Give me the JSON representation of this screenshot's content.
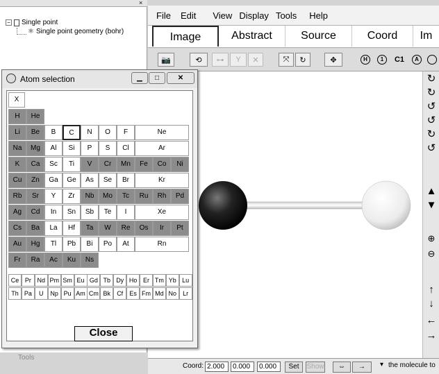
{
  "tree": {
    "root_label": "Single point",
    "child_label": "Single point geometry (bohr)",
    "collapse_glyph": "⊟",
    "close_glyph": "×"
  },
  "tools_label": "Tools",
  "menu": [
    "File",
    "Edit",
    "View",
    "Display",
    "Tools",
    "Help"
  ],
  "tabs": [
    "Image",
    "Abstract",
    "Source",
    "Coord",
    "Im"
  ],
  "toolbar_labels": {
    "h": "H",
    "one": "1",
    "c1": "C1",
    "a": "A"
  },
  "molecule": {
    "atoms": [
      {
        "element": "C",
        "color": "#1a1a1a"
      },
      {
        "element": "H",
        "color": "#f2f2f2"
      }
    ]
  },
  "right_tools": [
    "rotate-x-icon",
    "rotate-y-icon",
    "rotate-z-icon",
    "rotate-reverse-icon",
    "rotate-c-icon",
    "rotate-undo-icon",
    "arrow-up-icon",
    "arrow-down-icon",
    "zoom-in-icon",
    "zoom-out-icon",
    "move-up-icon",
    "move-down-icon",
    "move-left-icon",
    "move-right-icon"
  ],
  "status": {
    "coord_label": "Coord:",
    "x": "2.000",
    "y": "0.000",
    "z": "0.000",
    "set_label": "Set",
    "show_label": "Show",
    "message": "the molecule to"
  },
  "atom_dialog": {
    "title": "Atom selection",
    "clear_label": "X",
    "close_label": "Close",
    "selected": "C",
    "rows": [
      [
        "H",
        "He"
      ],
      [
        "Li",
        "Be",
        "B",
        "C",
        "N",
        "O",
        "F",
        "Ne"
      ],
      [
        "Na",
        "Mg",
        "Al",
        "Si",
        "P",
        "S",
        "Cl",
        "Ar"
      ],
      [
        "K",
        "Ca",
        "Sc",
        "Ti",
        "V",
        "Cr",
        "Mn",
        "Fe",
        "Co",
        "Ni"
      ],
      [
        "Cu",
        "Zn",
        "Ga",
        "Ge",
        "As",
        "Se",
        "Br",
        "Kr"
      ],
      [
        "Rb",
        "Sr",
        "Y",
        "Zr",
        "Nb",
        "Mo",
        "Tc",
        "Ru",
        "Rh",
        "Pd"
      ],
      [
        "Ag",
        "Cd",
        "In",
        "Sn",
        "Sb",
        "Te",
        "I",
        "Xe"
      ],
      [
        "Cs",
        "Ba",
        "La",
        "Hf",
        "Ta",
        "W",
        "Re",
        "Os",
        "Ir",
        "Pt"
      ],
      [
        "Au",
        "Hg",
        "Tl",
        "Pb",
        "Bi",
        "Po",
        "At",
        "Rn"
      ],
      [
        "Fr",
        "Ra",
        "Ac",
        "Ku",
        "Ns"
      ]
    ],
    "f_rows": [
      [
        "Ce",
        "Pr",
        "Nd",
        "Pm",
        "Sm",
        "Eu",
        "Gd",
        "Tb",
        "Dy",
        "Ho",
        "Er",
        "Tm",
        "Yb",
        "Lu"
      ],
      [
        "Th",
        "Pa",
        "U",
        "Np",
        "Pu",
        "Am",
        "Cm",
        "Bk",
        "Cf",
        "Es",
        "Fm",
        "Md",
        "No",
        "Lr"
      ]
    ]
  }
}
